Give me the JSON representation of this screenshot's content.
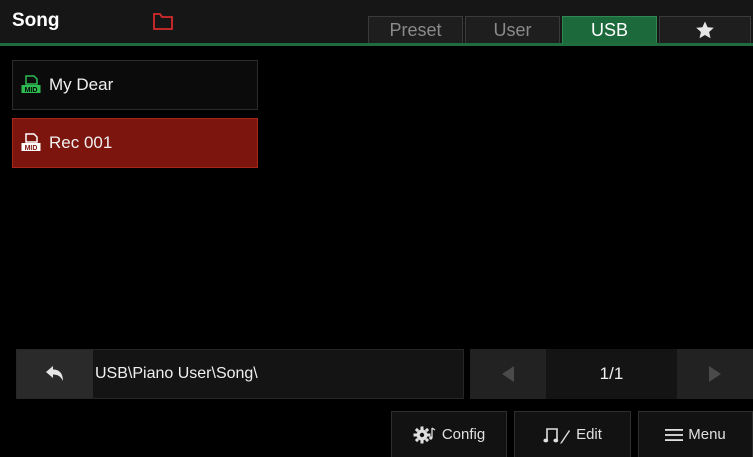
{
  "header": {
    "title": "Song",
    "tabs": [
      {
        "label": "Preset",
        "active": false
      },
      {
        "label": "User",
        "active": false
      },
      {
        "label": "USB",
        "active": true
      },
      {
        "label": "",
        "icon": "star-icon",
        "active": false
      }
    ]
  },
  "songs": [
    {
      "name": "My Dear",
      "icon": "midi-file-icon",
      "icon_color": "#2dbb52",
      "selected": false
    },
    {
      "name": "Rec 001",
      "icon": "midi-file-icon",
      "icon_color": "#ffffff",
      "selected": true
    }
  ],
  "path": {
    "text": "USB\\Piano User\\Song\\"
  },
  "pager": {
    "page": "1/1"
  },
  "buttons": {
    "config": "Config",
    "edit": "Edit",
    "menu": "Menu"
  },
  "colors": {
    "accent": "#1c6a3b",
    "selected": "#7d150f",
    "folder": "#d62a2a"
  }
}
